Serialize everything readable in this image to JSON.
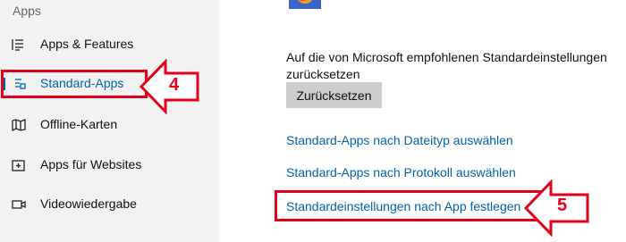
{
  "sidebar": {
    "section_title": "Apps",
    "items": [
      {
        "label": "Apps & Features",
        "icon": "apps-features-icon"
      },
      {
        "label": "Standard-Apps",
        "icon": "default-apps-icon",
        "active": true
      },
      {
        "label": "Offline-Karten",
        "icon": "map-icon"
      },
      {
        "label": "Apps für Websites",
        "icon": "website-apps-icon"
      },
      {
        "label": "Videowiedergabe",
        "icon": "video-icon"
      }
    ]
  },
  "main": {
    "reset_description": "Auf die von Microsoft empfohlenen Standardeinstellungen zurücksetzen",
    "reset_button_label": "Zurücksetzen",
    "links": [
      "Standard-Apps nach Dateityp auswählen",
      "Standard-Apps nach Protokoll auswählen",
      "Standardeinstellungen nach App festlegen"
    ]
  },
  "annotations": {
    "step_4": "4",
    "step_5": "5"
  },
  "colors": {
    "accent": "#0063b1",
    "annotation_red": "#e2001a",
    "sidebar_bg": "#f2f2f2",
    "main_bg": "#ffffff",
    "button_bg": "#cccccc"
  }
}
